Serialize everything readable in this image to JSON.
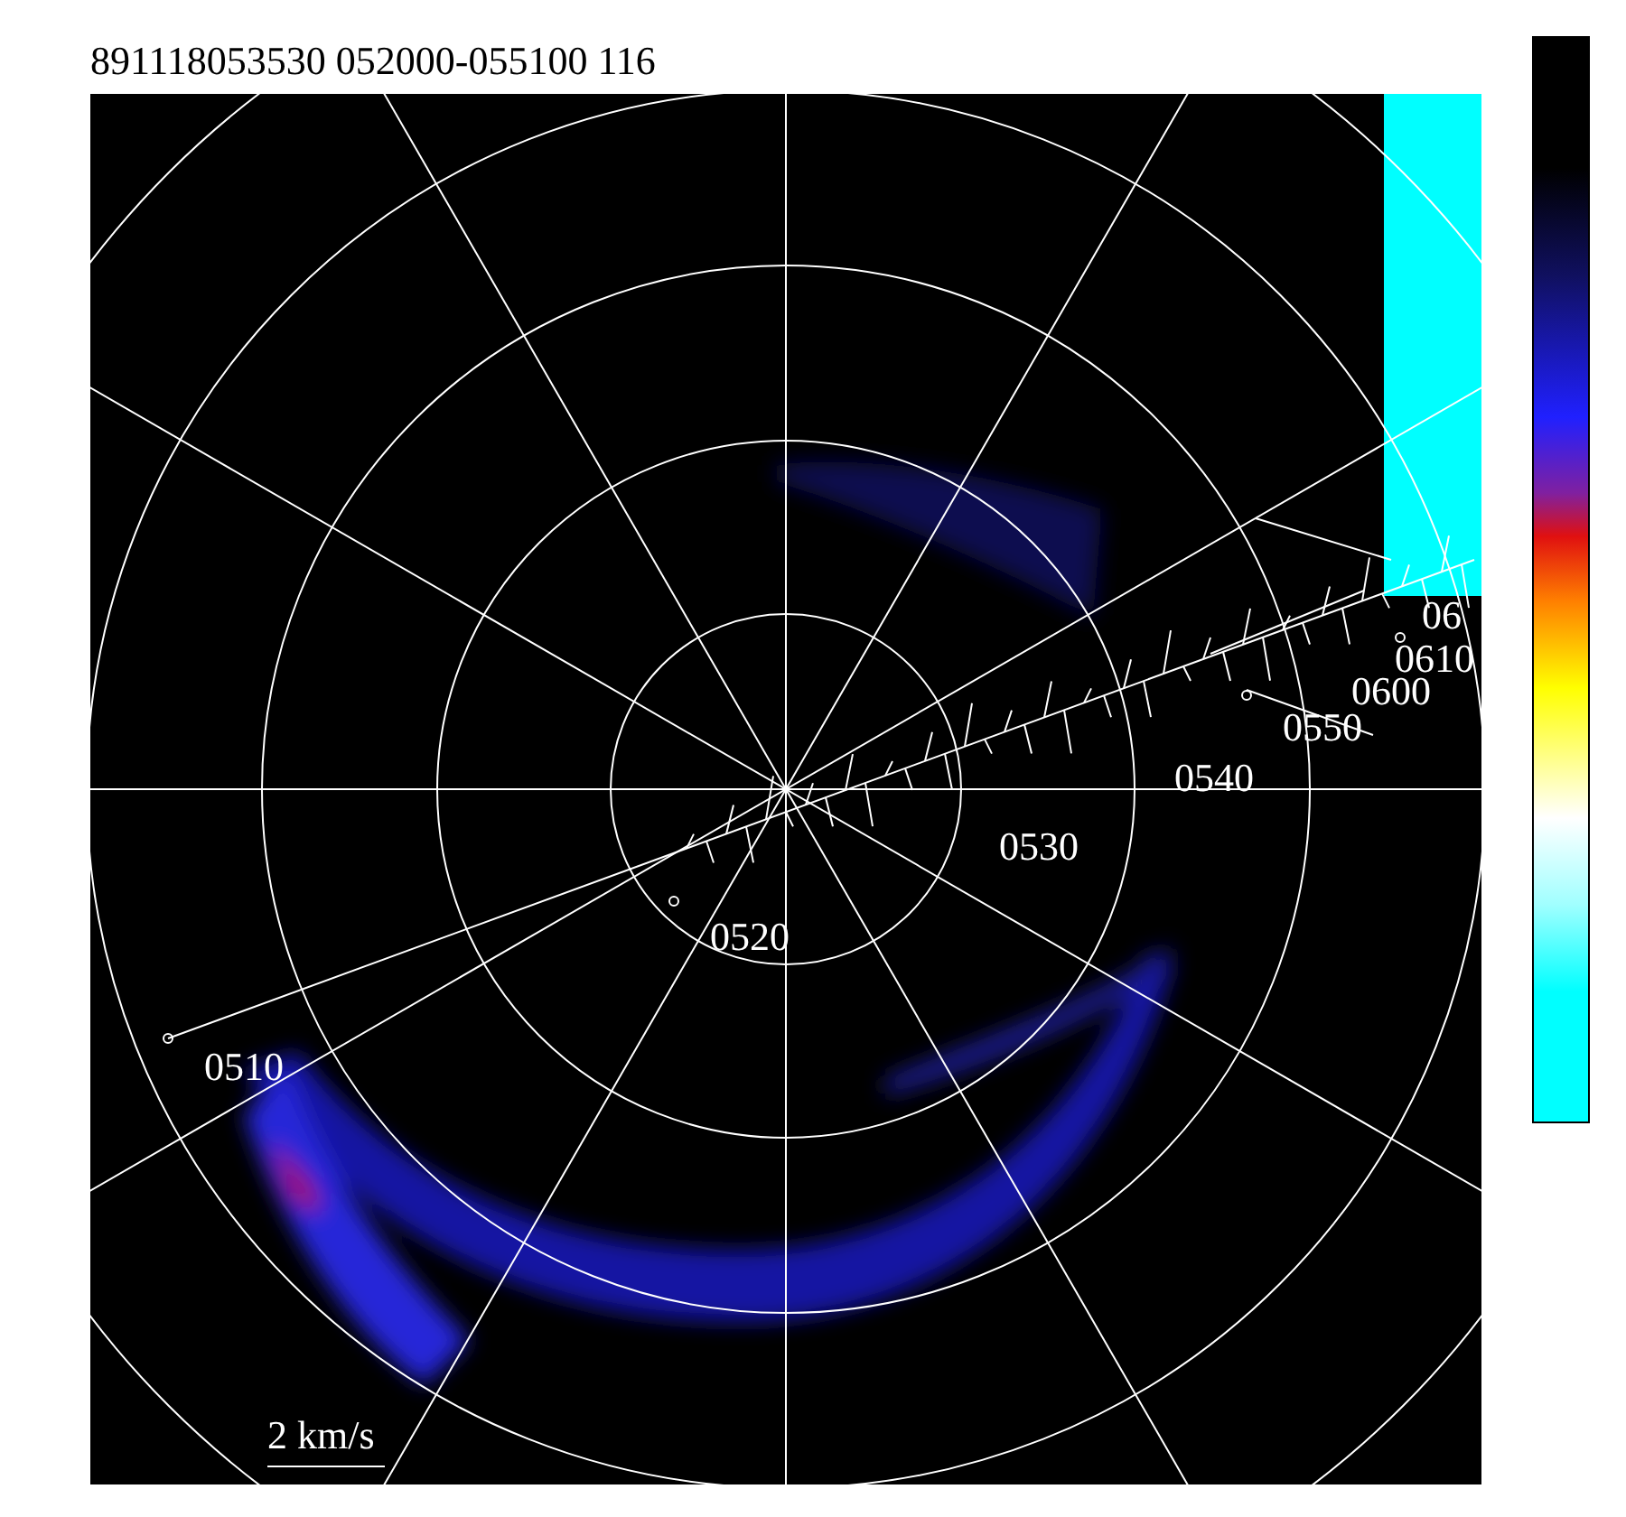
{
  "title": "891118053530 052000-055100 116",
  "plot": {
    "track_labels": [
      "0510",
      "0520",
      "0530",
      "0540",
      "0550",
      "0600",
      "0610",
      "06"
    ],
    "scale_label": "2 km/s"
  }
}
